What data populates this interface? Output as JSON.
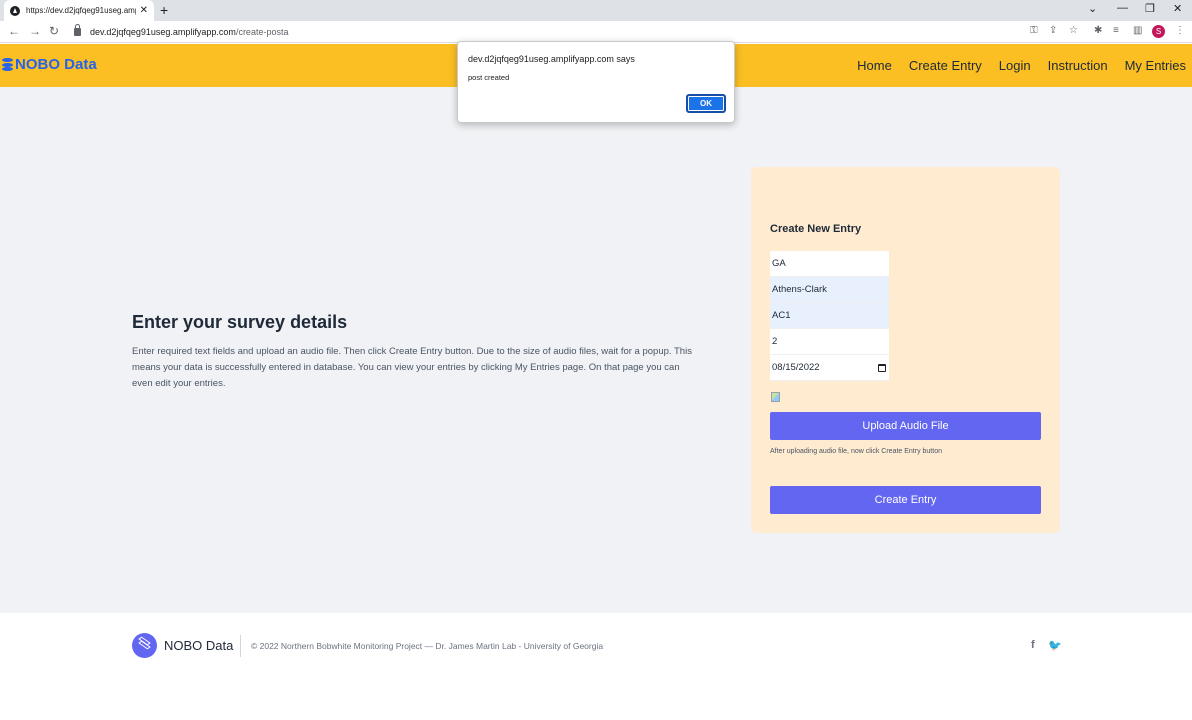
{
  "browser": {
    "tab_title": "https://dev.d2jqfqeg91useg.amp",
    "url_host": "dev.d2jqfqeg91useg.amplifyapp.com",
    "url_path": "/create-posta",
    "profile_initial": "S"
  },
  "header": {
    "brand": "NOBO Data",
    "nav": [
      "Home",
      "Create Entry",
      "Login",
      "Instruction",
      "My Entries"
    ],
    "bg_color": "#fbbf24",
    "brand_color": "#2563eb"
  },
  "hero": {
    "title": "Enter your survey details",
    "text": "Enter required text fields and upload an audio file. Then click Create Entry button. Due to the size of audio files, wait for a popup. This means your data is successfully entered in database. You can view your entries by clicking My Entries page. On that page you can even edit your entries."
  },
  "form": {
    "title": "Create New Entry",
    "fields": {
      "state": "GA",
      "county": "Athens-Clark",
      "site": "AC1",
      "count": "2",
      "date": "08/15/2022"
    },
    "upload_label": "Upload Audio File",
    "hint": "After uploading audio file, now click Create Entry button",
    "submit_label": "Create Entry",
    "button_color": "#6366f1",
    "card_color": "#feebd0"
  },
  "footer": {
    "brand": "NOBO Data",
    "copyright": "© 2022 Northern Bobwhite Monitoring Project — Dr. James Martin Lab - University of Georgia",
    "social_icons": [
      "facebook-icon",
      "twitter-icon"
    ]
  },
  "dialog": {
    "title": "dev.d2jqfqeg91useg.amplifyapp.com says",
    "message": "post created",
    "ok_label": "OK"
  }
}
